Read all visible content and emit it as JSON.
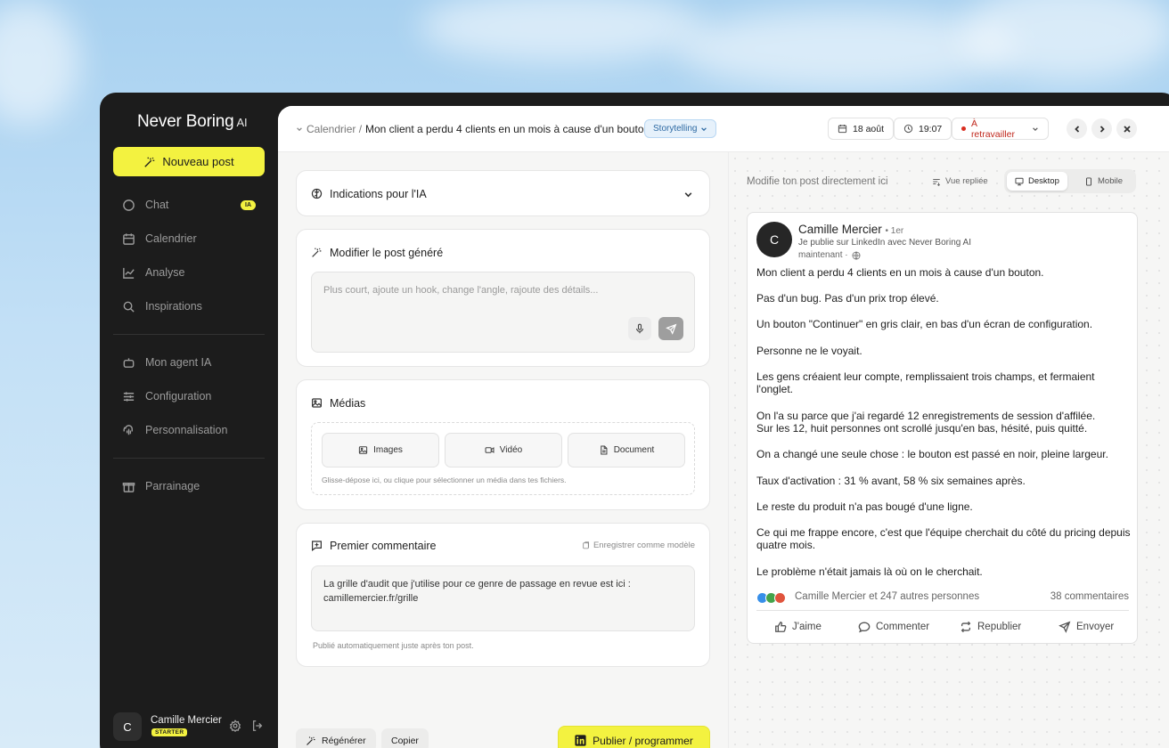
{
  "brand": {
    "name": "Never Boring",
    "suffix": "AI",
    "accent": "#f3f240"
  },
  "sidebar": {
    "new_post": "Nouveau post",
    "items": [
      {
        "label": "Chat",
        "icon": "chat-icon",
        "badge": "IA"
      },
      {
        "label": "Calendrier",
        "icon": "calendar-icon"
      },
      {
        "label": "Analyse",
        "icon": "chart-icon"
      },
      {
        "label": "Inspirations",
        "icon": "search-icon"
      },
      {
        "label": "Mon agent IA",
        "icon": "robot-icon"
      },
      {
        "label": "Configuration",
        "icon": "sliders-icon"
      },
      {
        "label": "Personnalisation",
        "icon": "fingerprint-icon"
      },
      {
        "label": "Parrainage",
        "icon": "gift-icon"
      }
    ],
    "user": {
      "initial": "C",
      "name": "Camille Mercier",
      "plan": "STARTER"
    }
  },
  "topbar": {
    "crumb": "Calendrier /",
    "title": "Mon client a perdu 4 clients en un mois à cause d'un bouton",
    "tag": "Storytelling",
    "date": "18 août",
    "time": "19:07",
    "status": "À retravailler",
    "status_color": "#d92d20"
  },
  "editor": {
    "ai_hints_title": "Indications pour l'IA",
    "edit_title": "Modifier le post généré",
    "edit_placeholder": "Plus court, ajoute un hook, change l'angle, rajoute des détails...",
    "media_title": "Médias",
    "media_buttons": [
      "Images",
      "Vidéo",
      "Document"
    ],
    "media_hint": "Glisse-dépose ici, ou clique pour sélectionner un média dans tes fichiers.",
    "comment_title": "Premier commentaire",
    "save_model": "Enregistrer comme modèle",
    "comment_text": "La grille d'audit que j'utilise pour ce genre de passage en revue est ici : camillemercier.fr/grille",
    "comment_hint": "Publié automatiquement juste après ton post.",
    "regen": "Régénérer",
    "copy": "Copier",
    "publish": "Publier / programmer"
  },
  "preview": {
    "hint": "Modifie ton post directement ici",
    "collapsed_view": "Vue repliée",
    "desktop": "Desktop",
    "mobile": "Mobile",
    "author": "Camille Mercier",
    "degree": "• 1er",
    "headline": "Je publie sur LinkedIn avec Never Boring AI",
    "time": "maintenant ·",
    "avatar_initial": "C",
    "paragraphs": [
      "Mon client a perdu 4 clients en un mois à cause d'un bouton.",
      "Pas d'un bug. Pas d'un prix trop élevé.",
      "Un bouton \"Continuer\" en gris clair, en bas d'un écran de configuration.",
      "Personne ne le voyait.",
      "Les gens créaient leur compte, remplissaient trois champs, et fermaient l'onglet.",
      "On l'a su parce que j'ai regardé 12 enregistrements de session d'affilée.\nSur les 12, huit personnes ont scrollé jusqu'en bas, hésité, puis quitté.",
      "On a changé une seule chose : le bouton est passé en noir, pleine largeur.",
      "Taux d'activation : 31 % avant, 58 % six semaines après.",
      "Le reste du produit n'a pas bougé d'une ligne.",
      "Ce qui me frappe encore, c'est que l'équipe cherchait du côté du pricing depuis quatre mois.",
      "Le problème n'était jamais là où on le cherchait."
    ],
    "reactions": "Camille Mercier et 247 autres personnes",
    "comments": "38 commentaires",
    "actions": [
      "J'aime",
      "Commenter",
      "Republier",
      "Envoyer"
    ]
  }
}
